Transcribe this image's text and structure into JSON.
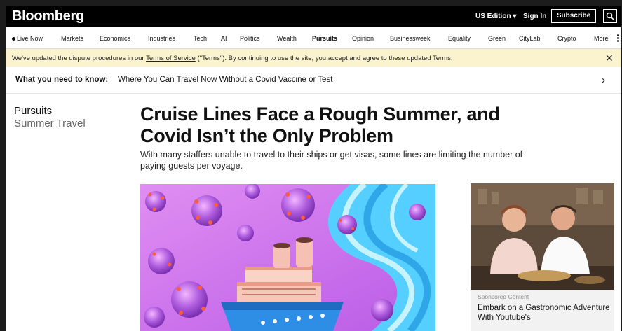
{
  "header": {
    "logo": "Bloomberg",
    "edition": "US Edition",
    "sign_in": "Sign In",
    "subscribe": "Subscribe"
  },
  "nav": {
    "items": [
      "Live Now",
      "Markets",
      "Economics",
      "Industries",
      "Tech",
      "AI",
      "Politics",
      "Wealth",
      "Pursuits",
      "Opinion",
      "Businessweek",
      "Equality",
      "Green",
      "CityLab",
      "Crypto",
      "More"
    ],
    "active": "Pursuits"
  },
  "banner": {
    "text_before": "We've updated the dispute procedures in our ",
    "link": "Terms of Service",
    "text_after": " (\"Terms\"). By continuing to use the site, you accept and agree to these updated Terms.",
    "close": "✕"
  },
  "know": {
    "label": "What you need to know:",
    "link": "Where You Can Travel Now Without a Covid Vaccine or Test",
    "chevron": "›"
  },
  "article": {
    "section": "Pursuits",
    "subsection": "Summer Travel",
    "headline": "Cruise Lines Face a Rough Summer, and Covid Isn’t the Only Problem",
    "dek": "With many staffers unable to travel to their ships or get visas, some lines are limiting the number of paying guests per voyage."
  },
  "sponsored": {
    "label": "Sponsored Content",
    "title": "Embark on a Gastronomic Adventure With Youtube's"
  },
  "colors": {
    "banner_bg": "#fbf3cd",
    "topbar_bg": "#000000",
    "hero_bg": "#c873e8"
  }
}
